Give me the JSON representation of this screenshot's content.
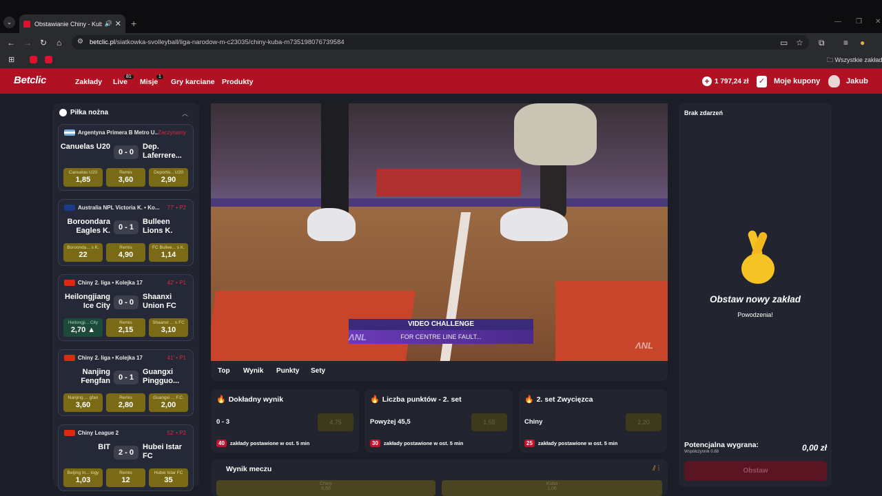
{
  "browser": {
    "tab_title": "Obstawianie Chiny - Kuba |",
    "url_host": "betclic.pl",
    "url_path": "/siatkowka-svolleyball/liga-narodow-m-c23035/chiny-kuba-m735198076739584",
    "bookmarks_all": "Wszystkie zakładki"
  },
  "header": {
    "logo": "Betclic",
    "nav": [
      {
        "label": "Zakłady"
      },
      {
        "label": "Live",
        "badge": "81"
      },
      {
        "label": "Misje",
        "badge": "1"
      },
      {
        "label": "Gry karciane"
      },
      {
        "label": "Produkty"
      }
    ],
    "balance": "1 797,24 zł",
    "coupons_label": "Moje kupony",
    "username": "Jakub",
    "brand_color": "#b01223"
  },
  "sidebar": {
    "title": "Piłka nożna",
    "events": [
      {
        "league": "Argentyna Primera B Metro U...",
        "status": "Zaczynamy",
        "team1": "Canuelas U20",
        "team2": "Dep. Laferrere...",
        "score": "0 - 0",
        "odds": [
          {
            "label": "Canuelas U20",
            "value": "1,85"
          },
          {
            "label": "Remis",
            "value": "3,60"
          },
          {
            "label": "Deportiv... U20",
            "value": "2,90"
          }
        ]
      },
      {
        "league": "Australia NPL Victoria K. • Ko...",
        "status": "77' • P2",
        "team1": "Boroondara Eagles K.",
        "team2": "Bulleen Lions K.",
        "score": "0 - 1",
        "odds": [
          {
            "label": "Boroonda... s K.",
            "value": "22"
          },
          {
            "label": "Remis",
            "value": "4,90"
          },
          {
            "label": "FC Bullee... s K.",
            "value": "1,14"
          }
        ]
      },
      {
        "league": "Chiny 2. liga • Kolejka 17",
        "status": "42' • P1",
        "team1": "Heilongjiang Ice City",
        "team2": "Shaanxi Union FC",
        "score": "0 - 0",
        "odds": [
          {
            "label": "Heilongji... City",
            "value": "2,70 ▲"
          },
          {
            "label": "Remis",
            "value": "2,15"
          },
          {
            "label": "Shaanxi ... n FC",
            "value": "3,10"
          }
        ]
      },
      {
        "league": "Chiny 2. liga • Kolejka 17",
        "status": "41' • P1",
        "team1": "Nanjing Fengfan",
        "team2": "Guangxi Pingguo...",
        "score": "0 - 1",
        "odds": [
          {
            "label": "Nanjing ... gfan",
            "value": "3,60"
          },
          {
            "label": "Remis",
            "value": "2,80"
          },
          {
            "label": "Guangxi ... F.C.",
            "value": "2,00"
          }
        ]
      },
      {
        "league": "Chiny League 2",
        "status": "52' • P2",
        "team1": "BIT",
        "team2": "Hubei Istar FC",
        "score": "2 - 0",
        "odds": [
          {
            "label": "Beijing In... logy",
            "value": "1,03"
          },
          {
            "label": "Remis",
            "value": "12"
          },
          {
            "label": "Hubei Istar FC",
            "value": "35"
          }
        ]
      }
    ]
  },
  "video": {
    "banner_top": "VIDEO CHALLENGE",
    "banner_bottom": "FOR CENTRE LINE FAULT..."
  },
  "market_tabs": [
    "Top",
    "Wynik",
    "Punkty",
    "Sety"
  ],
  "markets": [
    {
      "title": "Dokładny wynik",
      "selection": "0 - 3",
      "odd": "4,75",
      "count": "40",
      "count_text": "zakłady postawione w ost. 5 min"
    },
    {
      "title": "Liczba punktów - 2. set",
      "selection": "Powyżej 45,5",
      "odd": "1,55",
      "count": "30",
      "count_text": "zakłady postawione w ost. 5 min"
    },
    {
      "title": "2. set Zwycięzca",
      "selection": "Chiny",
      "odd": "2,20",
      "count": "25",
      "count_text": "zakłady postawione w ost. 5 min"
    }
  ],
  "match_result": {
    "title": "Wynik meczu",
    "odds": [
      {
        "label": "Chiny",
        "value": "6,50"
      },
      {
        "label": "Kuba",
        "value": "1,06"
      }
    ]
  },
  "betslip": {
    "empty": "Brak zdarzeń",
    "cta": "Obstaw nowy zakład",
    "luck": "Powodzenia!",
    "potential_label": "Potencjalna wygrana:",
    "coefficient": "Współczynnik 0.88",
    "potential_value": "0,00 zł",
    "button": "Obstaw"
  }
}
